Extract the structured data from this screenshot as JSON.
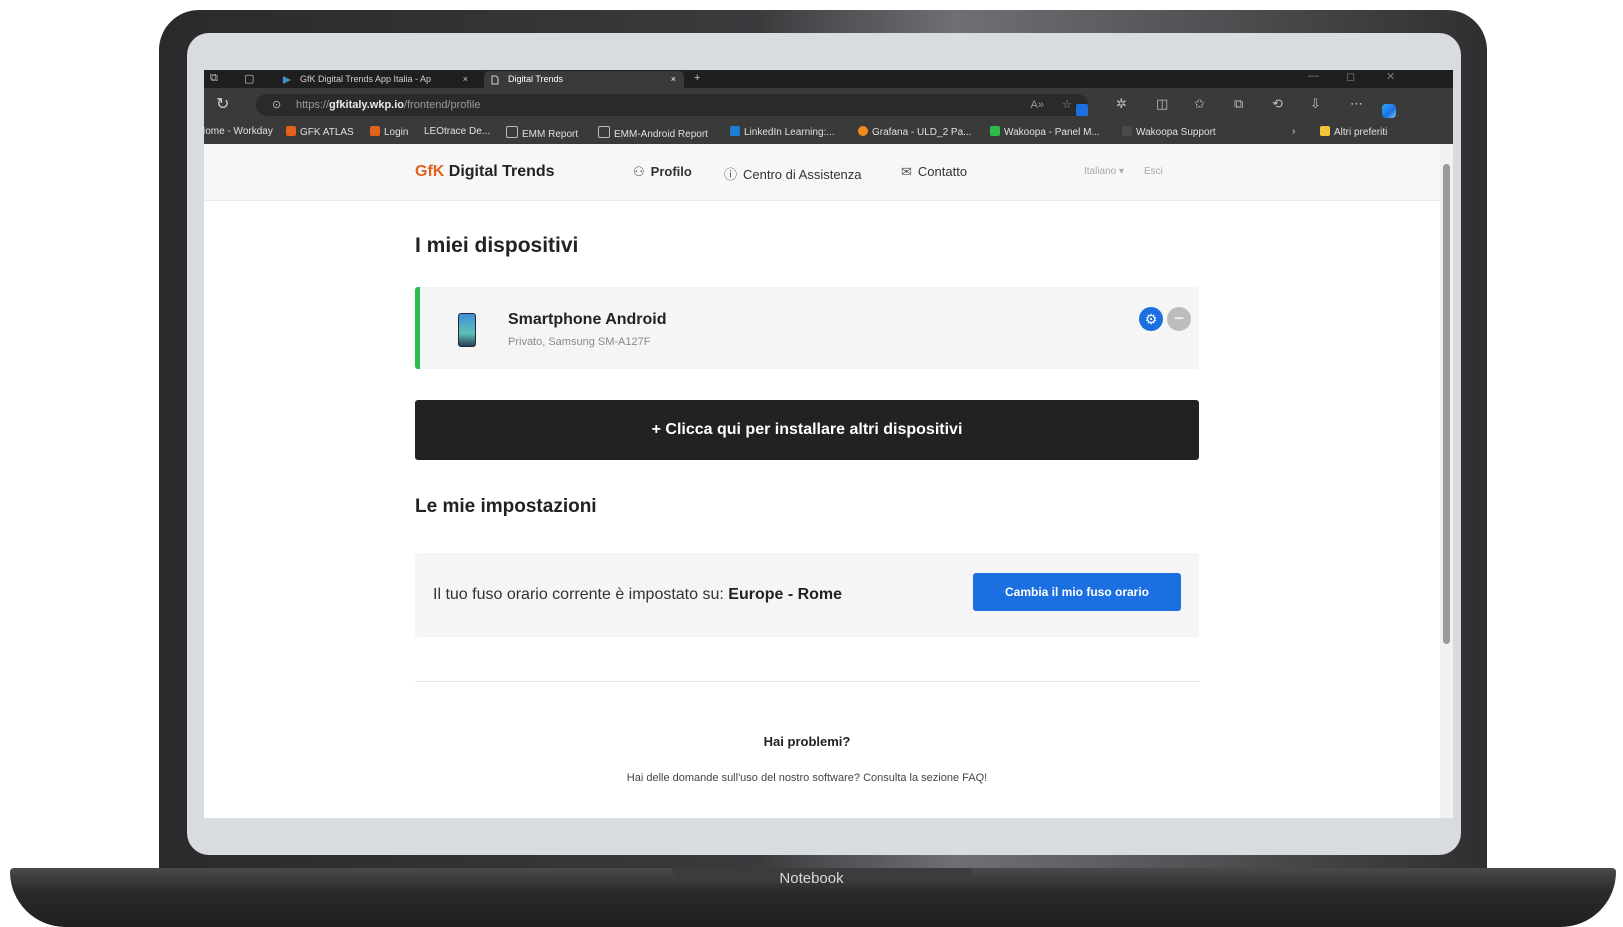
{
  "browser": {
    "tabs": [
      {
        "title": "GfK Digital Trends App Italia - Ap",
        "active": false
      },
      {
        "title": "Digital Trends",
        "active": true
      }
    ],
    "new_tab_symbol": "+",
    "tab_close_symbol": "×",
    "url_prefix": "https://",
    "url_domain": "gfkitaly.wkp.io",
    "url_path": "/frontend/profile",
    "bookmarks": [
      "Home - Workday",
      "GFK ATLAS",
      "Login",
      "LEOtrace De...",
      "EMM Report",
      "EMM-Android Report",
      "LinkedIn Learning:...",
      "Grafana - ULD_2 Pa...",
      "Wakoopa - Panel M...",
      "Wakoopa Support",
      "Altri preferiti"
    ],
    "bookmark_colors": [
      "#7a7a7a",
      "#e2611b",
      "#e2611b",
      "#7a7a7a",
      "#7a7a7a",
      "#7a7a7a",
      "#1c7fd6",
      "#f08c1e",
      "#2bbb4b",
      "#4a4a4a",
      "#f3c33b"
    ]
  },
  "nav": {
    "logo_brand": "GfK",
    "logo_name": "Digital Trends",
    "profile": "Profilo",
    "help_center": "Centro di Assistenza",
    "contact": "Contatto",
    "language": "Italiano",
    "logout": "Esci"
  },
  "devices": {
    "heading": "I miei dispositivi",
    "items": [
      {
        "name": "Smartphone Android",
        "detail": "Privato, Samsung SM-A127F"
      }
    ],
    "install_button": "+ Clicca qui per installare altri dispositivi"
  },
  "settings": {
    "heading": "Le mie impostazioni",
    "timezone_text": "Il tuo fuso orario corrente è impostato su:",
    "timezone_value": "Europe - Rome",
    "change_button": "Cambia il mio fuso orario"
  },
  "help": {
    "title": "Hai problemi?",
    "text": "Hai delle domande sull'uso del nostro software? Consulta la sezione FAQ!"
  },
  "device_label": "Notebook",
  "colors": {
    "brand_orange": "#e2611b",
    "primary_blue": "#1c6fe0",
    "active_green": "#2bbb4b",
    "dark_button": "#222222"
  }
}
